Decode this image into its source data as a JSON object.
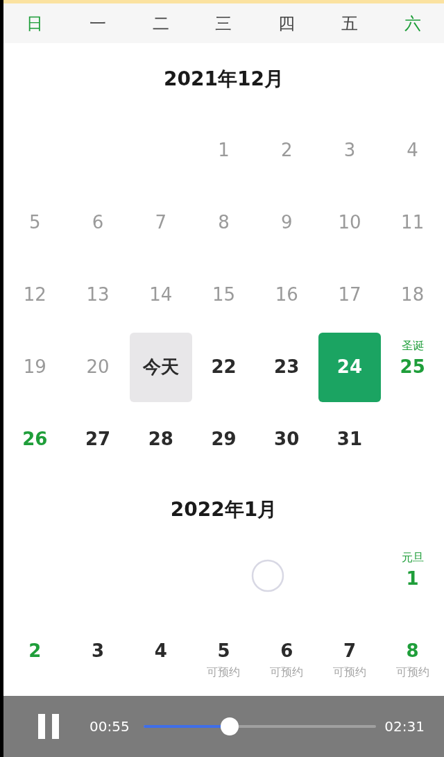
{
  "weekdays": [
    {
      "label": "日",
      "weekend": true
    },
    {
      "label": "一",
      "weekend": false
    },
    {
      "label": "二",
      "weekend": false
    },
    {
      "label": "三",
      "weekend": false
    },
    {
      "label": "四",
      "weekend": false
    },
    {
      "label": "五",
      "weekend": false
    },
    {
      "label": "六",
      "weekend": true
    }
  ],
  "months": [
    {
      "title": "2021年12月",
      "weeks": [
        [
          {
            "kind": "blank"
          },
          {
            "kind": "blank"
          },
          {
            "kind": "blank"
          },
          {
            "label": "1",
            "kind": "past"
          },
          {
            "label": "2",
            "kind": "past"
          },
          {
            "label": "3",
            "kind": "past"
          },
          {
            "label": "4",
            "kind": "past"
          }
        ],
        [
          {
            "label": "5",
            "kind": "past"
          },
          {
            "label": "6",
            "kind": "past"
          },
          {
            "label": "7",
            "kind": "past"
          },
          {
            "label": "8",
            "kind": "past"
          },
          {
            "label": "9",
            "kind": "past"
          },
          {
            "label": "10",
            "kind": "past"
          },
          {
            "label": "11",
            "kind": "past"
          }
        ],
        [
          {
            "label": "12",
            "kind": "past"
          },
          {
            "label": "13",
            "kind": "past"
          },
          {
            "label": "14",
            "kind": "past"
          },
          {
            "label": "15",
            "kind": "past"
          },
          {
            "label": "16",
            "kind": "past"
          },
          {
            "label": "17",
            "kind": "past"
          },
          {
            "label": "18",
            "kind": "past"
          }
        ],
        [
          {
            "label": "19",
            "kind": "past"
          },
          {
            "label": "20",
            "kind": "past"
          },
          {
            "label": "今天",
            "kind": "today"
          },
          {
            "label": "22",
            "kind": "future"
          },
          {
            "label": "23",
            "kind": "future"
          },
          {
            "label": "24",
            "kind": "selected"
          },
          {
            "label": "25",
            "kind": "weekend",
            "note": "圣诞"
          }
        ],
        [
          {
            "label": "26",
            "kind": "weekend"
          },
          {
            "label": "27",
            "kind": "future"
          },
          {
            "label": "28",
            "kind": "future"
          },
          {
            "label": "29",
            "kind": "future"
          },
          {
            "label": "30",
            "kind": "future"
          },
          {
            "label": "31",
            "kind": "future"
          }
        ]
      ]
    },
    {
      "title": "2022年1月",
      "loading": true,
      "weeks": [
        [
          {
            "kind": "blank"
          },
          {
            "kind": "blank"
          },
          {
            "kind": "blank"
          },
          {
            "kind": "blank"
          },
          {
            "kind": "blank"
          },
          {
            "kind": "blank"
          },
          {
            "label": "1",
            "kind": "weekend",
            "note": "元旦"
          }
        ],
        [
          {
            "label": "2",
            "kind": "weekend"
          },
          {
            "label": "3",
            "kind": "future"
          },
          {
            "label": "4",
            "kind": "future"
          },
          {
            "label": "5",
            "kind": "future",
            "sublabel": "可预约"
          },
          {
            "label": "6",
            "kind": "future",
            "sublabel": "可预约"
          },
          {
            "label": "7",
            "kind": "future",
            "sublabel": "可预约"
          },
          {
            "label": "8",
            "kind": "weekend",
            "sublabel": "可预约"
          }
        ]
      ]
    }
  ],
  "video_player": {
    "playing": true,
    "elapsed": "00:55",
    "duration": "02:31",
    "level": 0.37
  }
}
